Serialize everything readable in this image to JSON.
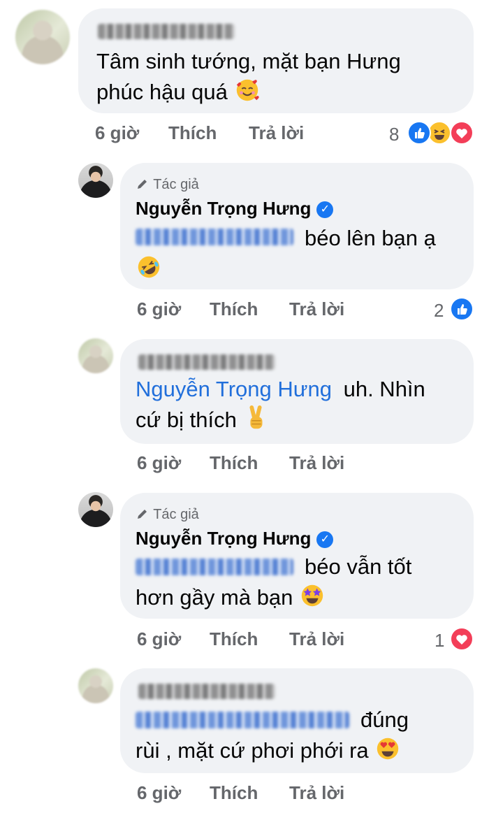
{
  "comments": [
    {
      "text_line1": "Tâm sinh tướng, mặt bạn Hưng",
      "text_line2": "phúc hậu quá",
      "time": "6 giờ",
      "like": "Thích",
      "reply": "Trả lời",
      "reaction_count": "8",
      "reactions": [
        "like-icon",
        "haha-icon",
        "love-icon"
      ]
    },
    {
      "author_tag": "Tác giả",
      "author": "Nguyễn Trọng Hưng",
      "text_line1": "béo lên bạn ạ",
      "time": "6 giờ",
      "like": "Thích",
      "reply": "Trả lời",
      "reaction_count": "2",
      "reactions": [
        "like-icon"
      ]
    },
    {
      "mention": "Nguyễn Trọng Hưng",
      "text_line1": "uh. Nhìn",
      "text_line2": "cứ bị thích",
      "time": "6 giờ",
      "like": "Thích",
      "reply": "Trả lời"
    },
    {
      "author_tag": "Tác giả",
      "author": "Nguyễn Trọng Hưng",
      "text_line1": "béo vẫn tốt",
      "text_line2": "hơn gầy mà bạn",
      "time": "6 giờ",
      "like": "Thích",
      "reply": "Trả lời",
      "reaction_count": "1",
      "reactions": [
        "love-icon"
      ]
    },
    {
      "text_line1": "đúng",
      "text_line2": "rùi , mặt cứ phơi phới ra",
      "time": "6 giờ",
      "like": "Thích",
      "reply": "Trả lời"
    }
  ],
  "colors": {
    "bubble": "#f0f2f5",
    "link": "#216fdb",
    "meta": "#65676b",
    "like": "#1877f2",
    "love": "#f33e58"
  }
}
